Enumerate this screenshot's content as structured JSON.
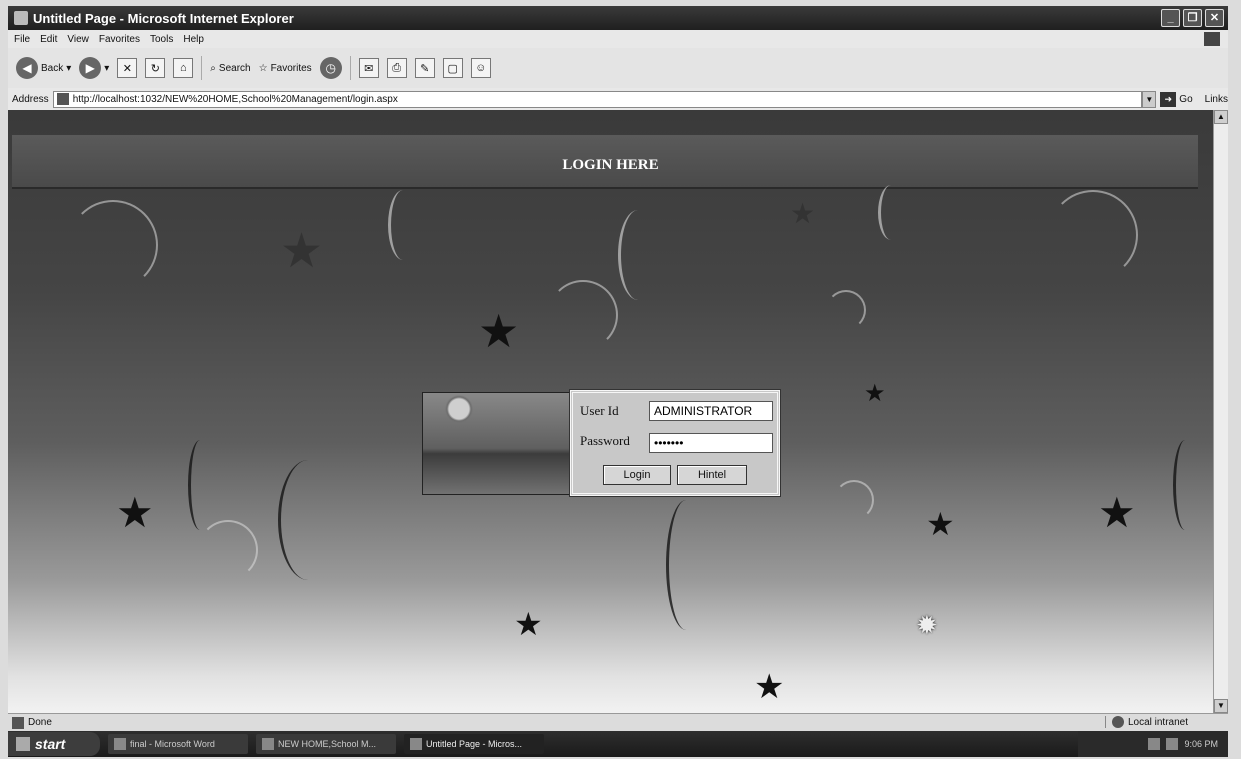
{
  "window": {
    "title": "Untitled Page - Microsoft Internet Explorer"
  },
  "menu": [
    "File",
    "Edit",
    "View",
    "Favorites",
    "Tools",
    "Help"
  ],
  "toolbar": {
    "back_label": "Back",
    "search_label": "Search",
    "favorites_label": "Favorites"
  },
  "address": {
    "label": "Address",
    "url": "http://localhost:1032/NEW%20HOME,School%20Management/login.aspx",
    "go_label": "Go",
    "links_label": "Links"
  },
  "page": {
    "heading": "LOGIN HERE",
    "form": {
      "userid_label": "User Id",
      "userid_value": "ADMINISTRATOR",
      "password_label": "Password",
      "password_value": "•••••••",
      "login_button": "Login",
      "cancel_button": "Hintel"
    }
  },
  "status": {
    "text": "Done",
    "zone": "Local intranet"
  },
  "taskbar": {
    "start_label": "start",
    "tasks": [
      "final - Microsoft Word",
      "NEW HOME,School M...",
      "Untitled Page - Micros..."
    ],
    "clock": "9:06 PM"
  },
  "colors": {
    "titlebar": "#2b2b2b",
    "page_background_top": "#3a3a3a",
    "page_background_bottom": "#f2f2f2",
    "login_box": "#c8c8c8"
  }
}
